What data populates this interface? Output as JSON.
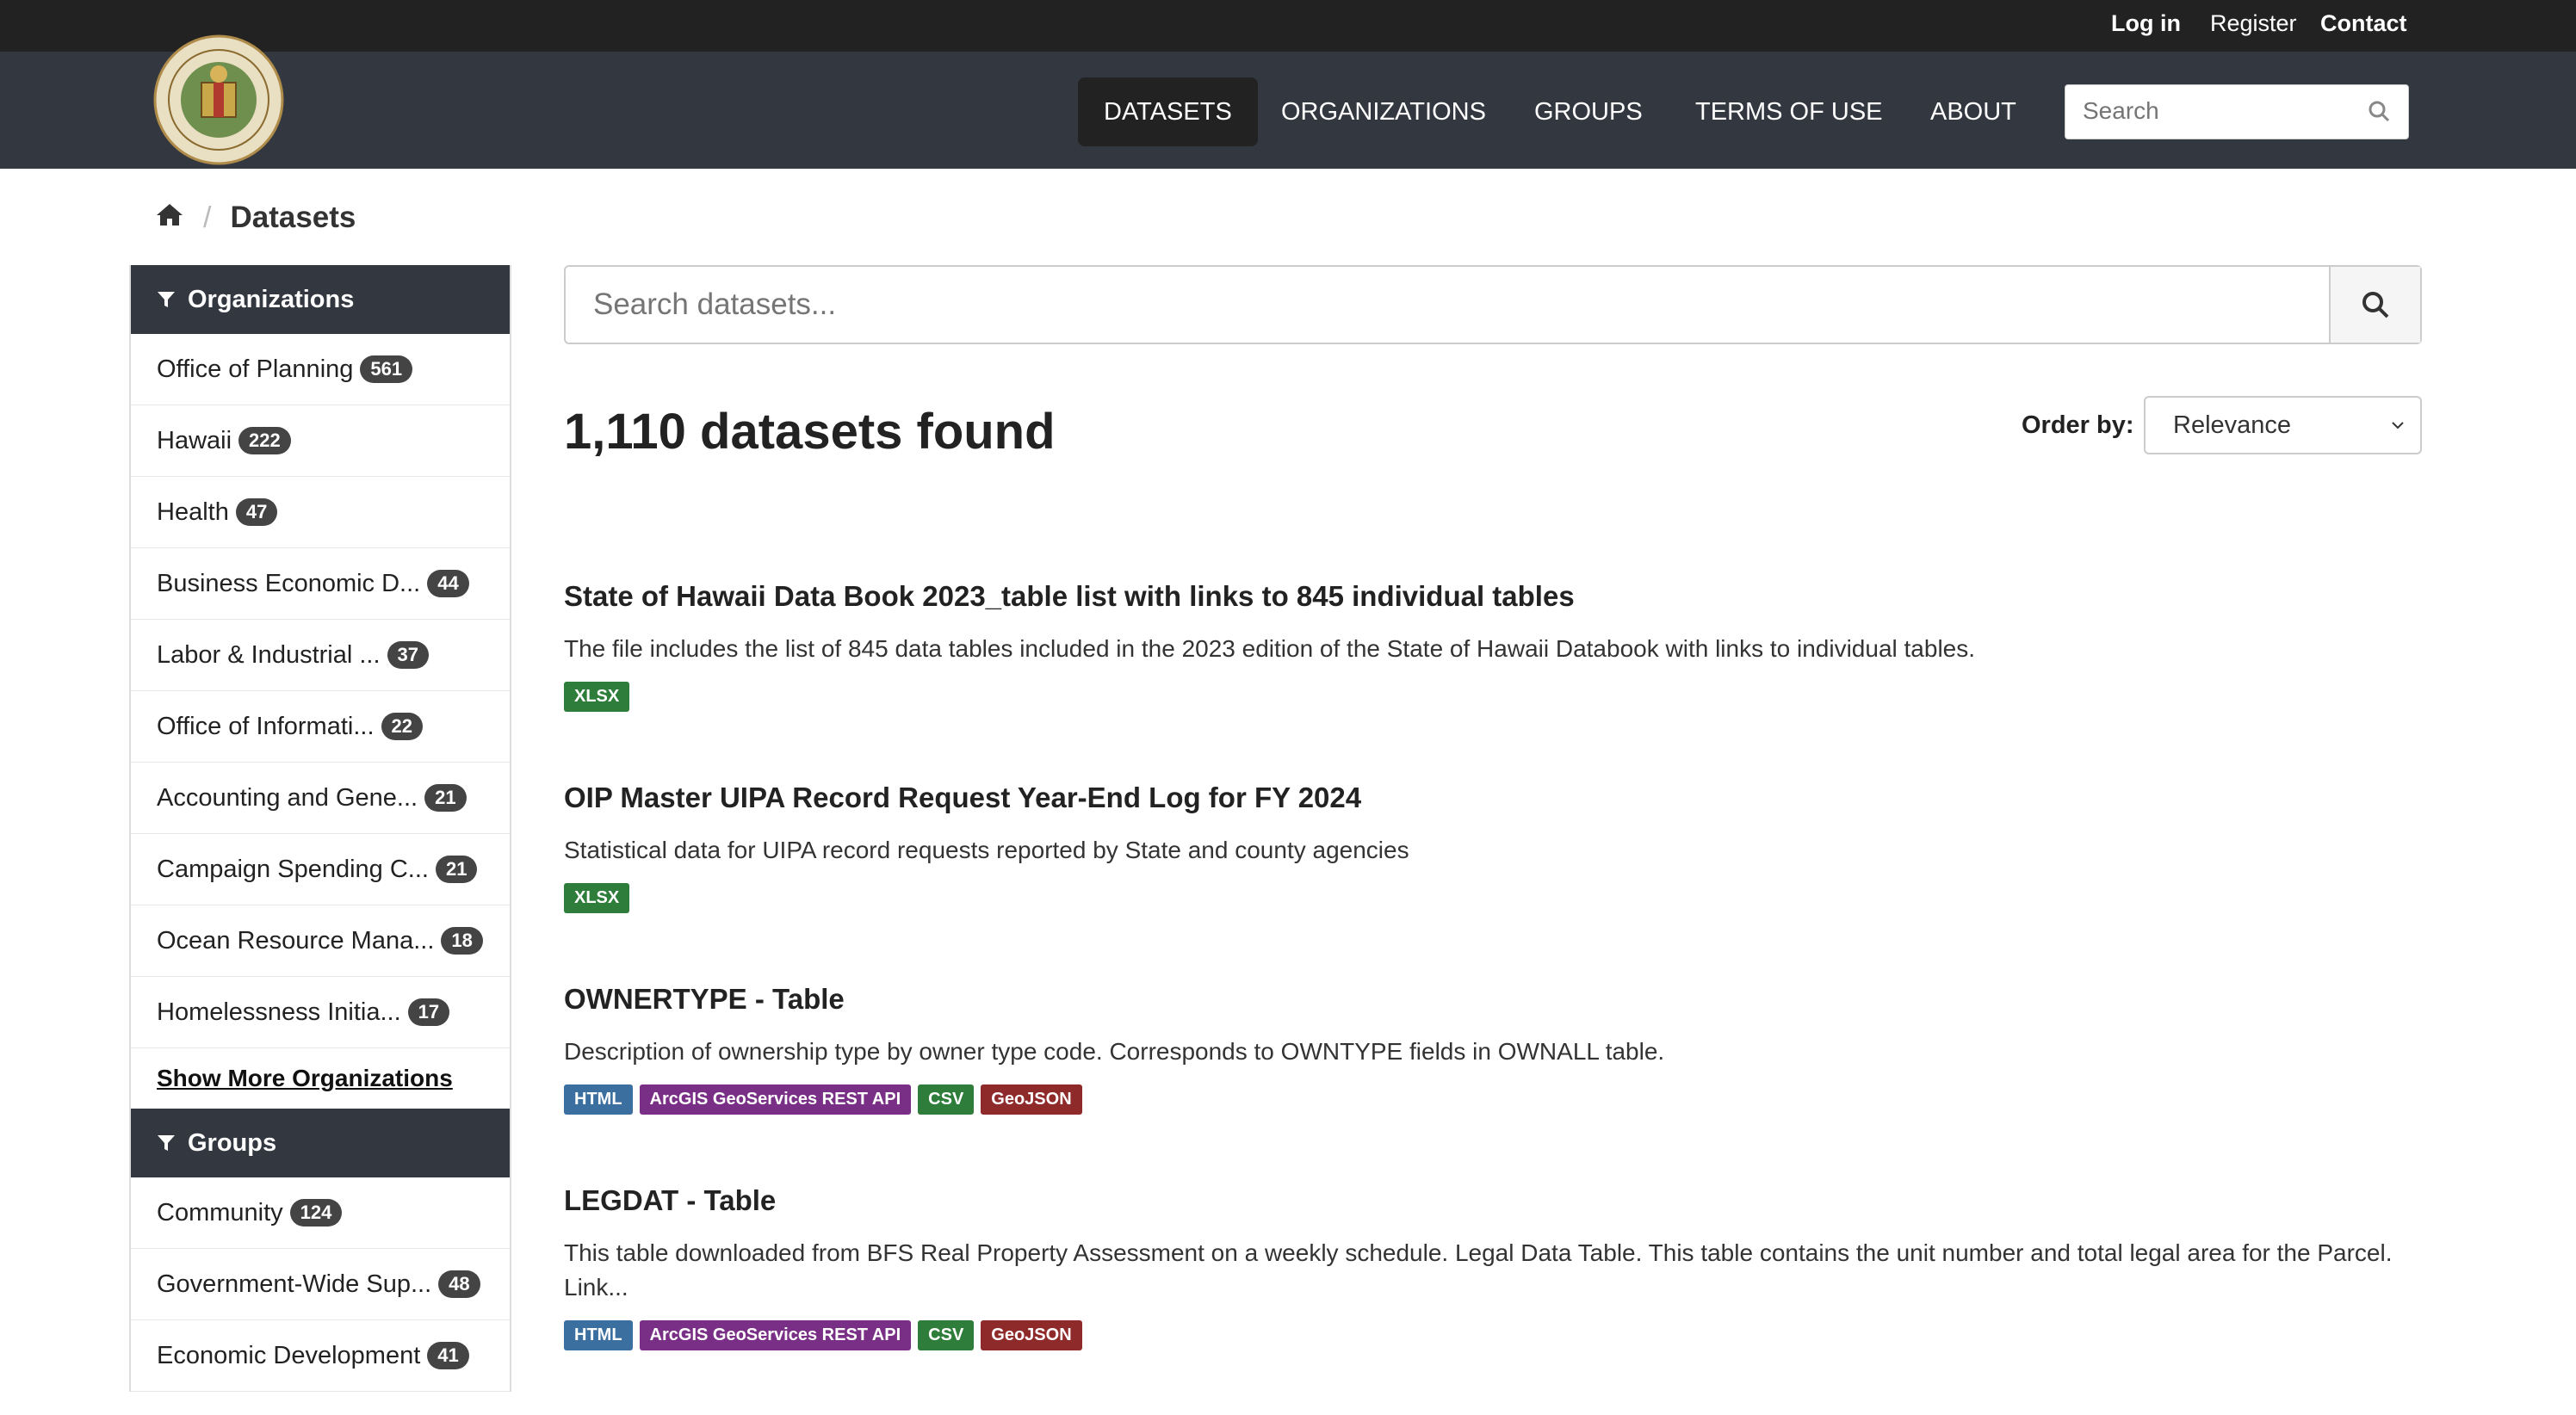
{
  "topbar": {
    "login": "Log in",
    "register": "Register",
    "contact": "Contact"
  },
  "nav": {
    "items": [
      "DATASETS",
      "ORGANIZATIONS",
      "GROUPS",
      "TERMS OF USE",
      "ABOUT"
    ],
    "search_placeholder": "Search"
  },
  "breadcrumb": {
    "current": "Datasets"
  },
  "sidebar": {
    "organizations_title": "Organizations",
    "organizations": [
      {
        "label": "Office of Planning",
        "count": "561"
      },
      {
        "label": "Hawaii",
        "count": "222"
      },
      {
        "label": "Health",
        "count": "47"
      },
      {
        "label": "Business Economic D...",
        "count": "44"
      },
      {
        "label": "Labor & Industrial ...",
        "count": "37"
      },
      {
        "label": "Office of Informati...",
        "count": "22"
      },
      {
        "label": "Accounting and Gene...",
        "count": "21"
      },
      {
        "label": "Campaign Spending C...",
        "count": "21"
      },
      {
        "label": "Ocean Resource Mana...",
        "count": "18"
      },
      {
        "label": "Homelessness Initia...",
        "count": "17"
      }
    ],
    "show_more": "Show More Organizations",
    "groups_title": "Groups",
    "groups": [
      {
        "label": "Community",
        "count": "124"
      },
      {
        "label": "Government-Wide Sup...",
        "count": "48"
      },
      {
        "label": "Economic Development",
        "count": "41"
      }
    ]
  },
  "search": {
    "placeholder": "Search datasets..."
  },
  "results": {
    "count_text": "1,110 datasets found",
    "order_label": "Order by:",
    "order_value": "Relevance"
  },
  "datasets": [
    {
      "title": "State of Hawaii Data Book 2023_table list with links to 845 individual tables",
      "description": "The file includes the list of 845 data tables included in the 2023 edition of the State of Hawaii Databook with links to individual tables.",
      "formats": [
        "XLSX"
      ]
    },
    {
      "title": "OIP Master UIPA Record Request Year-End Log for FY 2024",
      "description": "Statistical data for UIPA record requests reported by State and county agencies",
      "formats": [
        "XLSX"
      ]
    },
    {
      "title": "OWNERTYPE - Table",
      "description": "Description of ownership type by owner type code. Corresponds to OWNTYPE fields in OWNALL table.",
      "formats": [
        "HTML",
        "ArcGIS GeoServices REST API",
        "CSV",
        "GeoJSON"
      ]
    },
    {
      "title": "LEGDAT - Table",
      "description": "This table downloaded from BFS Real Property Assessment on a weekly schedule. Legal Data Table. This table contains the unit number and total legal area for the Parcel. Link...",
      "formats": [
        "HTML",
        "ArcGIS GeoServices REST API",
        "CSV",
        "GeoJSON"
      ]
    }
  ],
  "format_colors": {
    "XLSX": "#2f7d3a",
    "CSV": "#2f7d3a",
    "HTML": "#3b6fa0",
    "ArcGIS GeoServices REST API": "#7a2f86",
    "GeoJSON": "#8f2a2a"
  }
}
